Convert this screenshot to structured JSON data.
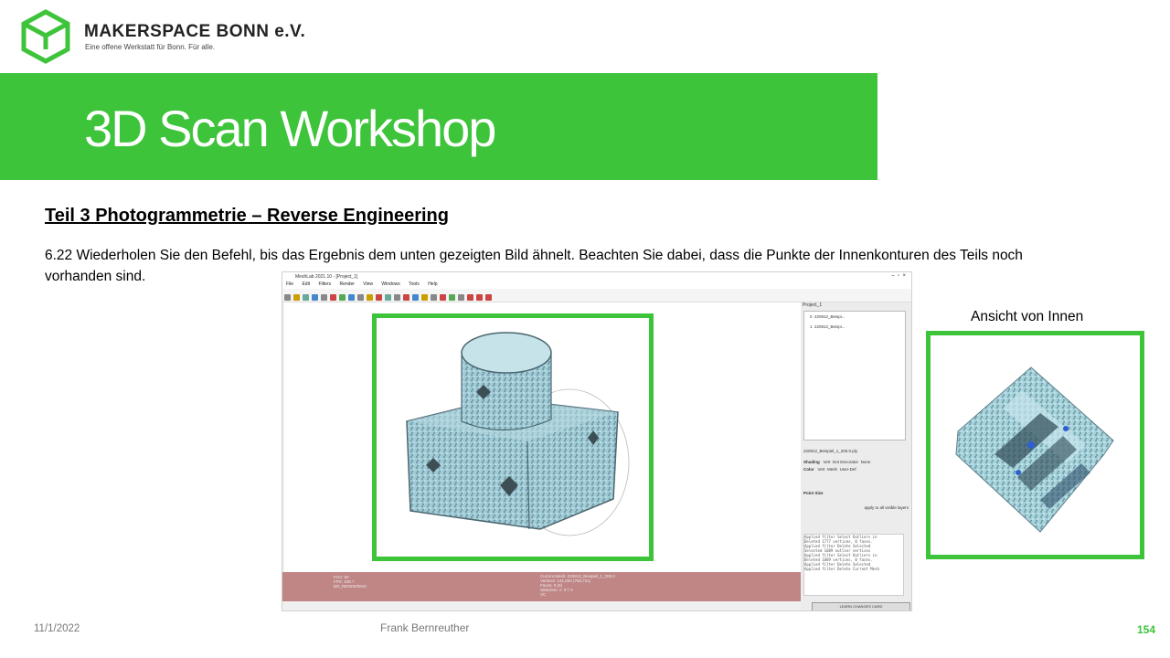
{
  "header": {
    "org_name": "MAKERSPACE BONN e.V.",
    "tagline": "Eine offene Werkstatt für Bonn. Für alle.",
    "brand_color": "#3dc43a",
    "logo_icon": "hexagon-cube-logo"
  },
  "slide": {
    "title": "3D Scan Workshop",
    "section_title": "Teil 3  Photogrammetrie  – Reverse Engineering",
    "body_text": "6.22 Wiederholen Sie den Befehl, bis das Ergebnis dem unten gezeigten Bild ähnelt. Beachten Sie dabei, dass die Punkte der Innenkonturen des Teils noch vorhanden sind.",
    "inner_view_label": "Ansicht von Innen"
  },
  "app": {
    "window_title": "MeshLab 2021.10 - [Project_1]",
    "menu": [
      "File",
      "Edit",
      "Filters",
      "Render",
      "View",
      "Windows",
      "Tools",
      "Help"
    ],
    "status_left": [
      "FOV: 60",
      "FPS: 108.7",
      "BO_RENDERING"
    ],
    "status_right": [
      "Current Mesh: 220912_Beispiel_1_200.0",
      "Vertices: 141,002 (760,721)",
      "Faces: 0 (0)",
      "Selection: v: 0 f: 0",
      "VC"
    ],
    "layer_panel_title": "Project_1",
    "layers": [
      {
        "index": "0",
        "name": "220912_Beispi..."
      },
      {
        "index": "1",
        "name": "220912_Beispi..."
      }
    ],
    "current_file": "220912_Beispiel_1_200.0.ply",
    "shading_label": "Shading",
    "shading_options": [
      "Vert",
      "Dot Decorator",
      "None"
    ],
    "color_label": "Color",
    "color_options": [
      "Vert",
      "Mesh",
      "User-Def"
    ],
    "point_size_label": "Point Size",
    "apply_all_label": "apply to all visible layers",
    "log": [
      "Applied filter Select Outliers in",
      "Deleted 1777 vertices, 0 faces.",
      "Applied filter Delete Selected",
      "Selected 1089 outlier vertices",
      "Applied filter Select Outliers in",
      "Deleted 1089 vertices, 0 faces.",
      "Applied filter Delete Selected",
      "Applied filter Delete Current Mesh"
    ],
    "log_button": "LEARN CHANGES CARD"
  },
  "footer": {
    "date": "11/1/2022",
    "author": "Frank Bernreuther",
    "page": "154"
  }
}
